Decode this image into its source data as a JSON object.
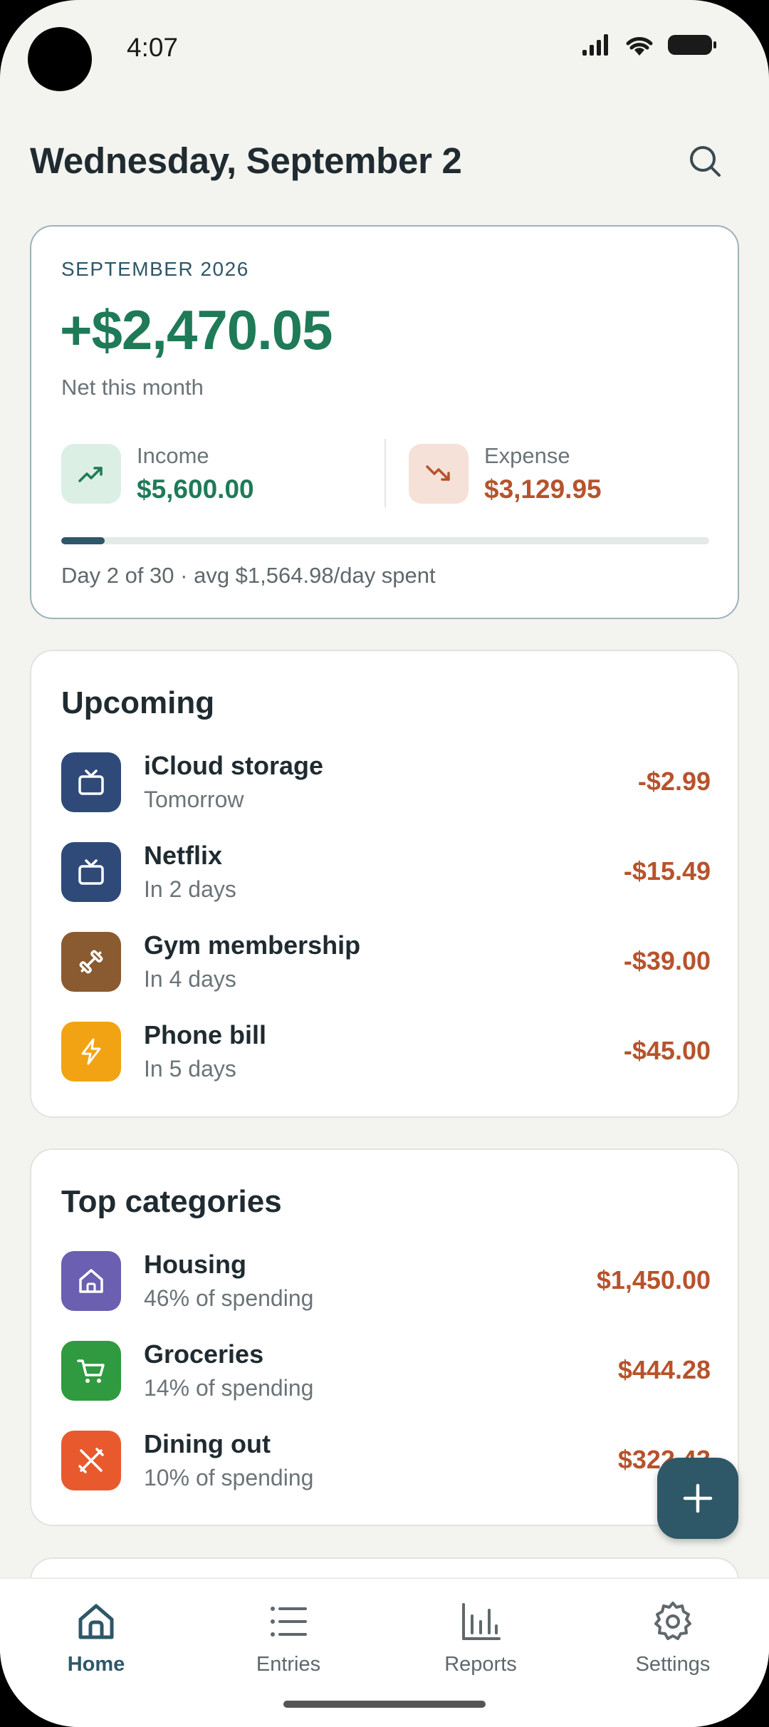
{
  "status_bar": {
    "time": "4:07"
  },
  "header": {
    "title": "Wednesday, September 2"
  },
  "summary": {
    "month": "SEPTEMBER 2026",
    "net_amount": "+$2,470.05",
    "net_label": "Net this month",
    "income_label": "Income",
    "income_value": "$5,600.00",
    "expense_label": "Expense",
    "expense_value": "$3,129.95",
    "progress_fraction": 0.067,
    "progress_caption": "Day 2 of 30 · avg $1,564.98/day spent"
  },
  "upcoming": {
    "title": "Upcoming",
    "items": [
      {
        "name": "iCloud storage",
        "when": "Tomorrow",
        "amount": "-$2.99",
        "icon": "tv-icon",
        "color": "#2f4a78"
      },
      {
        "name": "Netflix",
        "when": "In 2 days",
        "amount": "-$15.49",
        "icon": "tv-icon",
        "color": "#2f4a78"
      },
      {
        "name": "Gym membership",
        "when": "In 4 days",
        "amount": "-$39.00",
        "icon": "dumbbell-icon",
        "color": "#8a5a30"
      },
      {
        "name": "Phone bill",
        "when": "In 5 days",
        "amount": "-$45.00",
        "icon": "lightning-icon",
        "color": "#f2a313"
      }
    ]
  },
  "categories": {
    "title": "Top categories",
    "items": [
      {
        "name": "Housing",
        "share": "46% of spending",
        "amount": "$1,450.00",
        "icon": "house-icon",
        "color": "#6a5fb0"
      },
      {
        "name": "Groceries",
        "share": "14% of spending",
        "amount": "$444.28",
        "icon": "cart-icon",
        "color": "#2f9a3f"
      },
      {
        "name": "Dining out",
        "share": "10% of spending",
        "amount": "$322.43",
        "icon": "utensils-icon",
        "color": "#e85a2e"
      }
    ]
  },
  "nav": {
    "items": [
      {
        "label": "Home",
        "icon": "home-icon"
      },
      {
        "label": "Entries",
        "icon": "list-icon"
      },
      {
        "label": "Reports",
        "icon": "bar-chart-icon"
      },
      {
        "label": "Settings",
        "icon": "gear-icon"
      }
    ]
  },
  "colors": {
    "accent": "#2e5768",
    "income": "#1f7a57",
    "expense": "#b6532c"
  }
}
